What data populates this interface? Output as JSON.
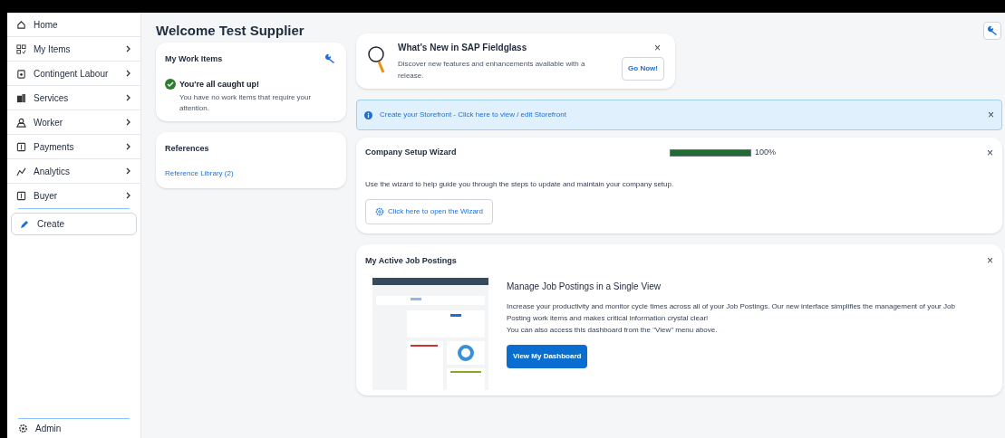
{
  "sidebar": {
    "items": [
      {
        "label": "Home",
        "kind": "link"
      },
      {
        "label": "My Items",
        "kind": "menu"
      },
      {
        "label": "Contingent Labour",
        "kind": "menu"
      },
      {
        "label": "Services",
        "kind": "menu"
      },
      {
        "label": "Worker",
        "kind": "menu"
      },
      {
        "label": "Payments",
        "kind": "menu"
      },
      {
        "label": "Analytics",
        "kind": "menu"
      },
      {
        "label": "Buyer",
        "kind": "menu"
      }
    ],
    "create_button": "Create",
    "admin": "Admin"
  },
  "page_title": "Welcome Test Supplier",
  "work_items": {
    "title": "My Work Items",
    "status": "You're all caught up!",
    "message": "You have no work items that require your attention."
  },
  "references": {
    "title": "References",
    "link": "Reference Library (2)"
  },
  "whats_new": {
    "title": "What's New in SAP Fieldglass",
    "text": "Discover new features and enhancements available with a release.",
    "button": "Go Now!",
    "close": "×"
  },
  "storefront_banner": {
    "text": "Create your Storefront - Click here to view / edit Storefront",
    "close": "×"
  },
  "setup_wizard": {
    "title": "Company Setup Wizard",
    "level": 1,
    "reading": "100%",
    "close": "×",
    "text": "Use the wizard to help guide you through the steps to update and maintain your company setup.",
    "button": "Click here to open the Wizard"
  },
  "job_postings": {
    "title": "My Active Job Postings",
    "close": "×",
    "heading": "Manage Job Postings in a Single View",
    "text": "Increase your productivity and monitor cycle times across all of your Job Postings. Our new interface simplifies the management of your Job Posting work items and makes critical information crystal clear!",
    "text_2": "You can also access this dashboard from the \"View\" menu above.",
    "button": "View My Dashboard"
  }
}
